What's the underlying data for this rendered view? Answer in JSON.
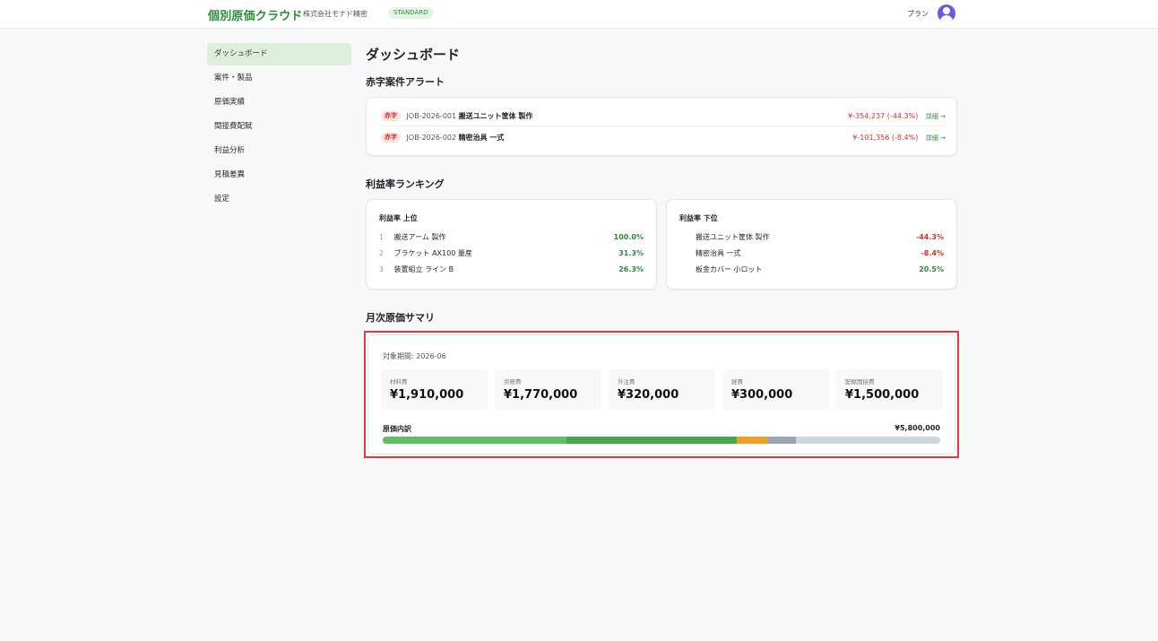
{
  "header": {
    "logo": "個別原価クラウド",
    "company": "株式会社モナド精密",
    "plan_badge": "STANDARD",
    "plan_link": "プラン"
  },
  "sidebar": {
    "items": [
      {
        "label": "ダッシュボード",
        "active": true
      },
      {
        "label": "案件・製品"
      },
      {
        "label": "原価実績"
      },
      {
        "label": "間接費配賦"
      },
      {
        "label": "利益分析"
      },
      {
        "label": "見積差異"
      },
      {
        "label": "設定"
      }
    ]
  },
  "main": {
    "title": "ダッシュボード",
    "alerts": {
      "title": "赤字案件アラート",
      "tag": "赤字",
      "detail": "詳細 →",
      "rows": [
        {
          "id": "JOB-2026-001",
          "name": "搬送ユニット筐体 製作",
          "loss": "¥-354,237 (-44.3%)"
        },
        {
          "id": "JOB-2026-002",
          "name": "精密治具 一式",
          "loss": "¥-101,356 (-8.4%)"
        }
      ]
    },
    "ranking": {
      "title": "利益率ランキング",
      "top": {
        "title": "利益率 上位",
        "rows": [
          {
            "rank": "1",
            "name": "搬送アーム 製作",
            "rate": "100.0%"
          },
          {
            "rank": "2",
            "name": "ブラケット AX100 量産",
            "rate": "31.3%"
          },
          {
            "rank": "3",
            "name": "装置組立 ライン B",
            "rate": "26.3%"
          }
        ]
      },
      "bottom": {
        "title": "利益率 下位",
        "rows": [
          {
            "name": "搬送ユニット筐体 製作",
            "rate": "-44.3%",
            "negative": true
          },
          {
            "name": "精密治具 一式",
            "rate": "-8.4%",
            "negative": true
          },
          {
            "name": "板金カバー 小ロット",
            "rate": "20.5%",
            "negative": false
          }
        ]
      }
    },
    "summary": {
      "title": "月次原価サマリ",
      "period": "対象期間: 2026-06",
      "costs": [
        {
          "label": "材料費",
          "value": "¥1,910,000"
        },
        {
          "label": "労務費",
          "value": "¥1,770,000"
        },
        {
          "label": "外注費",
          "value": "¥320,000"
        },
        {
          "label": "経費",
          "value": "¥300,000"
        },
        {
          "label": "配賦間接費",
          "value": "¥1,500,000"
        }
      ],
      "breakdown_label": "原価内訳",
      "total": "¥5,800,000",
      "breakdown": [
        {
          "label": "材料費",
          "amount": 1910000,
          "color": "#5cbf62"
        },
        {
          "label": "労務費",
          "amount": 1770000,
          "color": "#44a84d"
        },
        {
          "label": "外注費",
          "amount": 320000,
          "color": "#f0a020"
        },
        {
          "label": "経費",
          "amount": 300000,
          "color": "#98a4b3"
        },
        {
          "label": "配賦間接費",
          "amount": 1500000,
          "color": "#cfd6de"
        }
      ],
      "breakdown_total_amount": 5800000
    }
  },
  "colors": {
    "brand": "#2e8b3a",
    "danger": "#d93025",
    "highlight": "#e53935"
  }
}
